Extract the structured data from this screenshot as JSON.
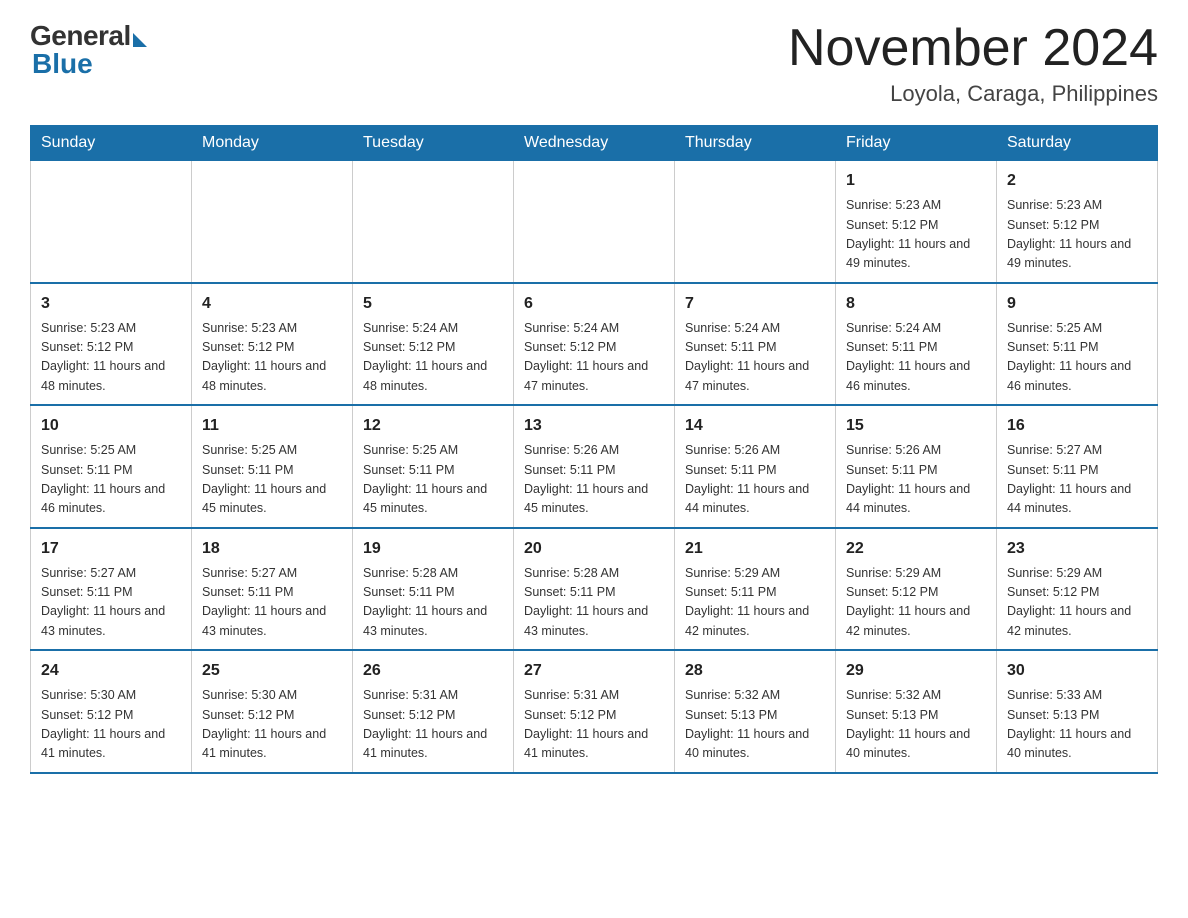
{
  "header": {
    "logo_general": "General",
    "logo_blue": "Blue",
    "month_title": "November 2024",
    "location": "Loyola, Caraga, Philippines"
  },
  "days_of_week": [
    "Sunday",
    "Monday",
    "Tuesday",
    "Wednesday",
    "Thursday",
    "Friday",
    "Saturday"
  ],
  "weeks": [
    {
      "days": [
        {
          "num": "",
          "sunrise": "",
          "sunset": "",
          "daylight": "",
          "empty": true
        },
        {
          "num": "",
          "sunrise": "",
          "sunset": "",
          "daylight": "",
          "empty": true
        },
        {
          "num": "",
          "sunrise": "",
          "sunset": "",
          "daylight": "",
          "empty": true
        },
        {
          "num": "",
          "sunrise": "",
          "sunset": "",
          "daylight": "",
          "empty": true
        },
        {
          "num": "",
          "sunrise": "",
          "sunset": "",
          "daylight": "",
          "empty": true
        },
        {
          "num": "1",
          "sunrise": "Sunrise: 5:23 AM",
          "sunset": "Sunset: 5:12 PM",
          "daylight": "Daylight: 11 hours and 49 minutes.",
          "empty": false
        },
        {
          "num": "2",
          "sunrise": "Sunrise: 5:23 AM",
          "sunset": "Sunset: 5:12 PM",
          "daylight": "Daylight: 11 hours and 49 minutes.",
          "empty": false
        }
      ]
    },
    {
      "days": [
        {
          "num": "3",
          "sunrise": "Sunrise: 5:23 AM",
          "sunset": "Sunset: 5:12 PM",
          "daylight": "Daylight: 11 hours and 48 minutes.",
          "empty": false
        },
        {
          "num": "4",
          "sunrise": "Sunrise: 5:23 AM",
          "sunset": "Sunset: 5:12 PM",
          "daylight": "Daylight: 11 hours and 48 minutes.",
          "empty": false
        },
        {
          "num": "5",
          "sunrise": "Sunrise: 5:24 AM",
          "sunset": "Sunset: 5:12 PM",
          "daylight": "Daylight: 11 hours and 48 minutes.",
          "empty": false
        },
        {
          "num": "6",
          "sunrise": "Sunrise: 5:24 AM",
          "sunset": "Sunset: 5:12 PM",
          "daylight": "Daylight: 11 hours and 47 minutes.",
          "empty": false
        },
        {
          "num": "7",
          "sunrise": "Sunrise: 5:24 AM",
          "sunset": "Sunset: 5:11 PM",
          "daylight": "Daylight: 11 hours and 47 minutes.",
          "empty": false
        },
        {
          "num": "8",
          "sunrise": "Sunrise: 5:24 AM",
          "sunset": "Sunset: 5:11 PM",
          "daylight": "Daylight: 11 hours and 46 minutes.",
          "empty": false
        },
        {
          "num": "9",
          "sunrise": "Sunrise: 5:25 AM",
          "sunset": "Sunset: 5:11 PM",
          "daylight": "Daylight: 11 hours and 46 minutes.",
          "empty": false
        }
      ]
    },
    {
      "days": [
        {
          "num": "10",
          "sunrise": "Sunrise: 5:25 AM",
          "sunset": "Sunset: 5:11 PM",
          "daylight": "Daylight: 11 hours and 46 minutes.",
          "empty": false
        },
        {
          "num": "11",
          "sunrise": "Sunrise: 5:25 AM",
          "sunset": "Sunset: 5:11 PM",
          "daylight": "Daylight: 11 hours and 45 minutes.",
          "empty": false
        },
        {
          "num": "12",
          "sunrise": "Sunrise: 5:25 AM",
          "sunset": "Sunset: 5:11 PM",
          "daylight": "Daylight: 11 hours and 45 minutes.",
          "empty": false
        },
        {
          "num": "13",
          "sunrise": "Sunrise: 5:26 AM",
          "sunset": "Sunset: 5:11 PM",
          "daylight": "Daylight: 11 hours and 45 minutes.",
          "empty": false
        },
        {
          "num": "14",
          "sunrise": "Sunrise: 5:26 AM",
          "sunset": "Sunset: 5:11 PM",
          "daylight": "Daylight: 11 hours and 44 minutes.",
          "empty": false
        },
        {
          "num": "15",
          "sunrise": "Sunrise: 5:26 AM",
          "sunset": "Sunset: 5:11 PM",
          "daylight": "Daylight: 11 hours and 44 minutes.",
          "empty": false
        },
        {
          "num": "16",
          "sunrise": "Sunrise: 5:27 AM",
          "sunset": "Sunset: 5:11 PM",
          "daylight": "Daylight: 11 hours and 44 minutes.",
          "empty": false
        }
      ]
    },
    {
      "days": [
        {
          "num": "17",
          "sunrise": "Sunrise: 5:27 AM",
          "sunset": "Sunset: 5:11 PM",
          "daylight": "Daylight: 11 hours and 43 minutes.",
          "empty": false
        },
        {
          "num": "18",
          "sunrise": "Sunrise: 5:27 AM",
          "sunset": "Sunset: 5:11 PM",
          "daylight": "Daylight: 11 hours and 43 minutes.",
          "empty": false
        },
        {
          "num": "19",
          "sunrise": "Sunrise: 5:28 AM",
          "sunset": "Sunset: 5:11 PM",
          "daylight": "Daylight: 11 hours and 43 minutes.",
          "empty": false
        },
        {
          "num": "20",
          "sunrise": "Sunrise: 5:28 AM",
          "sunset": "Sunset: 5:11 PM",
          "daylight": "Daylight: 11 hours and 43 minutes.",
          "empty": false
        },
        {
          "num": "21",
          "sunrise": "Sunrise: 5:29 AM",
          "sunset": "Sunset: 5:11 PM",
          "daylight": "Daylight: 11 hours and 42 minutes.",
          "empty": false
        },
        {
          "num": "22",
          "sunrise": "Sunrise: 5:29 AM",
          "sunset": "Sunset: 5:12 PM",
          "daylight": "Daylight: 11 hours and 42 minutes.",
          "empty": false
        },
        {
          "num": "23",
          "sunrise": "Sunrise: 5:29 AM",
          "sunset": "Sunset: 5:12 PM",
          "daylight": "Daylight: 11 hours and 42 minutes.",
          "empty": false
        }
      ]
    },
    {
      "days": [
        {
          "num": "24",
          "sunrise": "Sunrise: 5:30 AM",
          "sunset": "Sunset: 5:12 PM",
          "daylight": "Daylight: 11 hours and 41 minutes.",
          "empty": false
        },
        {
          "num": "25",
          "sunrise": "Sunrise: 5:30 AM",
          "sunset": "Sunset: 5:12 PM",
          "daylight": "Daylight: 11 hours and 41 minutes.",
          "empty": false
        },
        {
          "num": "26",
          "sunrise": "Sunrise: 5:31 AM",
          "sunset": "Sunset: 5:12 PM",
          "daylight": "Daylight: 11 hours and 41 minutes.",
          "empty": false
        },
        {
          "num": "27",
          "sunrise": "Sunrise: 5:31 AM",
          "sunset": "Sunset: 5:12 PM",
          "daylight": "Daylight: 11 hours and 41 minutes.",
          "empty": false
        },
        {
          "num": "28",
          "sunrise": "Sunrise: 5:32 AM",
          "sunset": "Sunset: 5:13 PM",
          "daylight": "Daylight: 11 hours and 40 minutes.",
          "empty": false
        },
        {
          "num": "29",
          "sunrise": "Sunrise: 5:32 AM",
          "sunset": "Sunset: 5:13 PM",
          "daylight": "Daylight: 11 hours and 40 minutes.",
          "empty": false
        },
        {
          "num": "30",
          "sunrise": "Sunrise: 5:33 AM",
          "sunset": "Sunset: 5:13 PM",
          "daylight": "Daylight: 11 hours and 40 minutes.",
          "empty": false
        }
      ]
    }
  ]
}
